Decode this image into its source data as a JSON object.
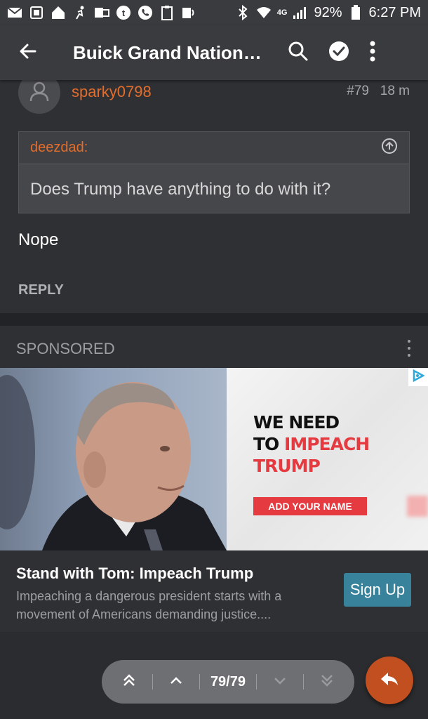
{
  "status_bar": {
    "battery": "92%",
    "time": "6:27 PM",
    "network": "4G"
  },
  "app_bar": {
    "title": "Buick Grand Nationa..."
  },
  "post": {
    "username": "sparky0798",
    "post_number": "#79",
    "age": "18 m",
    "quote_author": "deezdad:",
    "quote_text": "Does Trump have anything to do with it?",
    "body": "Nope",
    "reply_label": "REPLY"
  },
  "sponsored": {
    "label": "SPONSORED",
    "ad_line1": "WE NEED",
    "ad_line2_a": "TO ",
    "ad_line2_b": "IMPEACH",
    "ad_line3": "TRUMP",
    "ad_cta": "ADD YOUR NAME",
    "title": "Stand with Tom: Impeach Trump",
    "description": "Impeaching a dangerous president starts with a movement of Americans demanding justice....",
    "signup_label": "Sign Up"
  },
  "pager": {
    "page_indicator": "79/79"
  },
  "colors": {
    "accent": "#e36d2c",
    "fab": "#c24f1f",
    "signup": "#38829c",
    "ad_red": "#e53a3f"
  }
}
